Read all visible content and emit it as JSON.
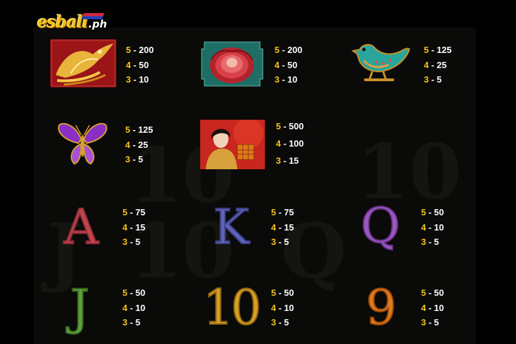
{
  "logo": {
    "main": "esball",
    "tld": ".ph"
  },
  "background_ghost": [
    "10",
    "10",
    "10",
    "Q",
    "J"
  ],
  "symbols": [
    {
      "name": "phoenix",
      "icon": "phoenix-icon",
      "pays": [
        {
          "n": "5",
          "v": "200"
        },
        {
          "n": "4",
          "v": "50"
        },
        {
          "n": "3",
          "v": "10"
        }
      ]
    },
    {
      "name": "peony",
      "icon": "peony-flower-icon",
      "pays": [
        {
          "n": "5",
          "v": "200"
        },
        {
          "n": "4",
          "v": "50"
        },
        {
          "n": "3",
          "v": "10"
        }
      ]
    },
    {
      "name": "bird",
      "icon": "jeweled-bird-icon",
      "pays": [
        {
          "n": "5",
          "v": "125"
        },
        {
          "n": "4",
          "v": "25"
        },
        {
          "n": "3",
          "v": "5"
        }
      ]
    },
    {
      "name": "butterfly",
      "icon": "butterfly-icon",
      "pays": [
        {
          "n": "5",
          "v": "125"
        },
        {
          "n": "4",
          "v": "25"
        },
        {
          "n": "3",
          "v": "5"
        }
      ]
    },
    {
      "name": "geisha",
      "icon": "geisha-icon",
      "pays": [
        {
          "n": "5",
          "v": "500"
        },
        {
          "n": "4",
          "v": "100"
        },
        {
          "n": "3",
          "v": "15"
        }
      ]
    },
    {
      "name": "A",
      "label": "A",
      "color": "#c0444e",
      "pays": [
        {
          "n": "5",
          "v": "75"
        },
        {
          "n": "4",
          "v": "15"
        },
        {
          "n": "3",
          "v": "5"
        }
      ]
    },
    {
      "name": "K",
      "label": "K",
      "color": "#5f63b8",
      "pays": [
        {
          "n": "5",
          "v": "75"
        },
        {
          "n": "4",
          "v": "15"
        },
        {
          "n": "3",
          "v": "5"
        }
      ]
    },
    {
      "name": "Q",
      "label": "Q",
      "color": "#9a57c2",
      "pays": [
        {
          "n": "5",
          "v": "50"
        },
        {
          "n": "4",
          "v": "10"
        },
        {
          "n": "3",
          "v": "5"
        }
      ]
    },
    {
      "name": "J",
      "label": "J",
      "color": "#5fa03a",
      "pays": [
        {
          "n": "5",
          "v": "50"
        },
        {
          "n": "4",
          "v": "10"
        },
        {
          "n": "3",
          "v": "5"
        }
      ]
    },
    {
      "name": "10",
      "label": "10",
      "color": "#d6a024",
      "pays": [
        {
          "n": "5",
          "v": "50"
        },
        {
          "n": "4",
          "v": "10"
        },
        {
          "n": "3",
          "v": "5"
        }
      ]
    },
    {
      "name": "9",
      "label": "9",
      "color": "#e07a1c",
      "pays": [
        {
          "n": "5",
          "v": "50"
        },
        {
          "n": "4",
          "v": "10"
        },
        {
          "n": "3",
          "v": "5"
        }
      ]
    }
  ],
  "separator": " - ",
  "colors": {
    "multiplier": "#f2c21a",
    "value": "#ffffff",
    "background": "#000000"
  }
}
